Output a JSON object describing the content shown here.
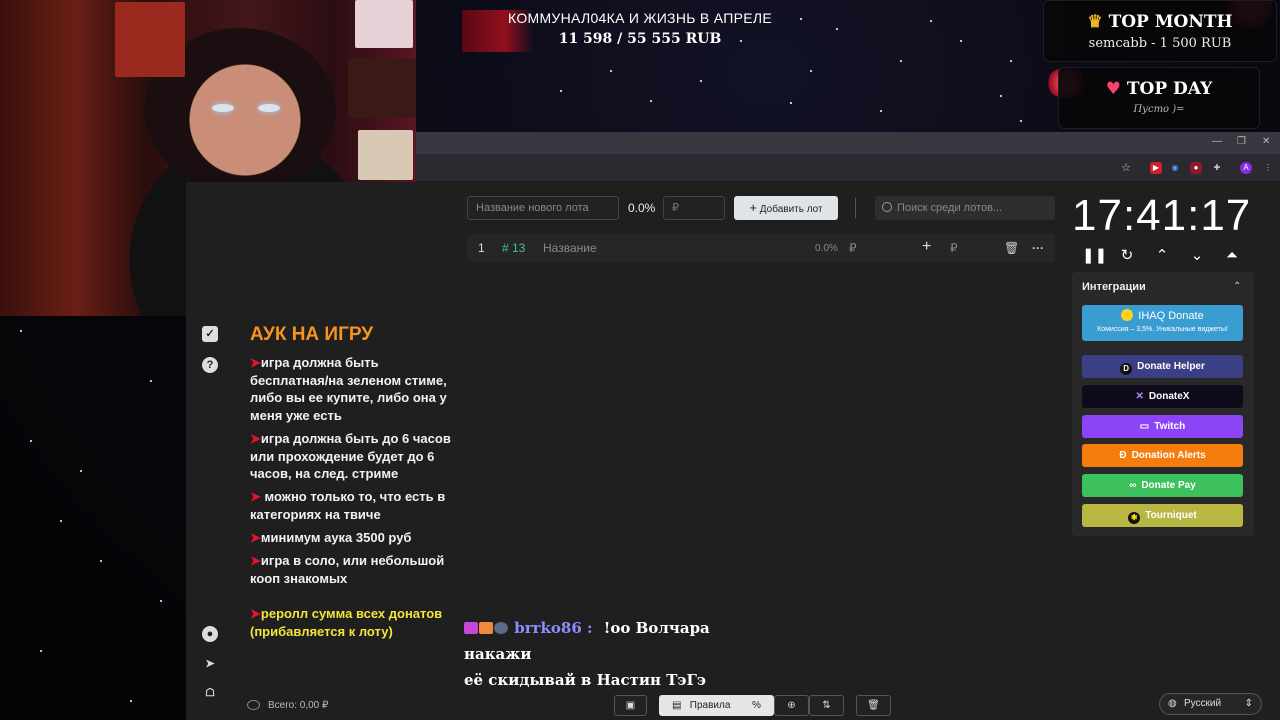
{
  "overlay": {
    "stream_title": "КОММУНАЛ04КА И ЖИЗНЬ В АПРЕЛЕ",
    "stream_goal": "11 598 / 55 555 RUB",
    "top_month": {
      "title": "TOP MONTH",
      "value": "semcabb - 1 500 RUB"
    },
    "top_day": {
      "title": "TOP DAY",
      "value": "Пусто )="
    }
  },
  "rules": {
    "title": "АУК НА ИГРУ",
    "items": [
      "игра должна быть бесплатная/на зеленом стиме, либо вы ее купите, либо она у меня уже есть",
      "игра должна быть до 6 часов или прохождение будет до 6 часов, на след. стриме",
      " можно только то, что есть в категориях на твиче",
      "минимум аука 3500 руб",
      "игра в соло, или небольшой кооп знакомых"
    ],
    "reroll": "реролл сумма всех донатов (прибавляется к лоту)",
    "arrow_glyph": "➤"
  },
  "lot_form": {
    "name_placeholder": "Название нового лота",
    "percent": "0.0%",
    "amount_placeholder": "₽",
    "add_button": "Добавить лот",
    "search_placeholder": "Поиск среди лотов..."
  },
  "lots": [
    {
      "index": "1",
      "id": "# 13",
      "name": "Название",
      "percent": "0.0%",
      "currency": "₽",
      "plus": "+",
      "currency2": "₽",
      "more": "···"
    }
  ],
  "timer": {
    "time": "17:41:17"
  },
  "integrations": {
    "title": "Интеграции",
    "ihaq": {
      "label": "IHAQ Donate",
      "sub": "Комиссия – 3,5%. Уникальные виджеты!"
    },
    "buttons": [
      {
        "label": "Donate Helper",
        "color": "#3b3f86"
      },
      {
        "label": "DonateX",
        "color": "#0f0a1c"
      },
      {
        "label": "Twitch",
        "color": "#8c44f7"
      },
      {
        "label": "Donation Alerts",
        "color": "#f57d0e"
      },
      {
        "label": "Donate Pay",
        "color": "#3cc05c"
      },
      {
        "label": "Tourniquet",
        "color": "#b9b743"
      }
    ]
  },
  "chat": {
    "user": "brrko86 :",
    "message_line1": "!оо Волчара накажи",
    "message_line2": "её скидывай в Настин ТэГэ"
  },
  "footer": {
    "total": "Всего: 0,00 ₽",
    "rules_button": "Правила",
    "percent_button": "%",
    "language": "Русский"
  },
  "colors": {
    "accent_orange": "#f7931e",
    "rule_arrow": "#e8132b",
    "reroll_yellow": "#f5e43a",
    "chat_user": "#8e8cff"
  }
}
